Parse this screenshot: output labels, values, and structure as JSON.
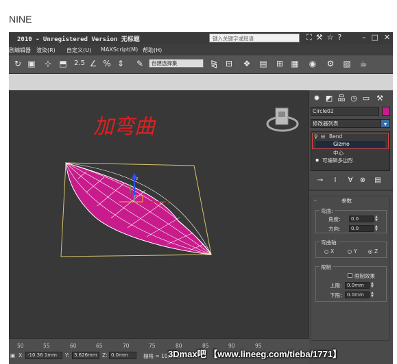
{
  "caption": "NINE",
  "titlebar": {
    "title": "2010  - Unregistered Version  无标题",
    "search_placeholder": "键入关键字或短语"
  },
  "menubar": {
    "items": [
      "剧编辑器",
      "渲染(R)",
      "自定义(U)",
      "MAXScript(M)",
      "帮助(H)"
    ]
  },
  "toolbar": {
    "snap_value": "2.5",
    "selection_set": "创建选择集"
  },
  "viewport": {
    "annotation": "加弯曲",
    "accent_color": "#c81c8c"
  },
  "command_panel": {
    "object_name": "Circle02",
    "object_color": "#c81c8c",
    "modifier_list_label": "修改器列表",
    "stack": {
      "bend": "Bend",
      "gizmo": "Gizmo",
      "center": "中心",
      "editable_poly": "可编辑多边形"
    },
    "params": {
      "title": "参数",
      "bend_group": "弯曲:",
      "angle_label": "角度:",
      "angle_value": "0.0",
      "direction_label": "方向:",
      "direction_value": "0.0",
      "axis_group": "弯曲轴:",
      "axis_x": "X",
      "axis_y": "Y",
      "axis_z": "Z",
      "limits_group": "限制",
      "limit_effect": "限制效果",
      "upper_label": "上限:",
      "upper_value": "0.0mm",
      "lower_label": "下限:",
      "lower_value": "0.0mm"
    }
  },
  "status": {
    "ruler": [
      "50",
      "55",
      "60",
      "65",
      "70",
      "75",
      "80",
      "85",
      "90",
      "95"
    ],
    "x_label": "X:",
    "x_value": "-10.36 1mm",
    "y_label": "Y:",
    "y_value": "3.626mm",
    "z_label": "Z:",
    "z_value": "0.0mm",
    "grid_label": "栅格 = 10.0mm"
  },
  "watermark": "3Dmax吧 【www.lineeg.com/tieba/1771】"
}
